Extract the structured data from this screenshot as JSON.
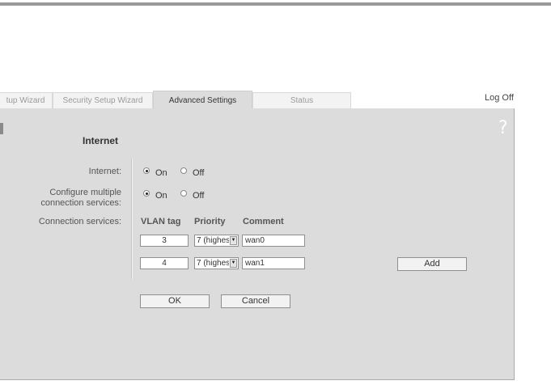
{
  "tabs": [
    {
      "label": "tup Wizard"
    },
    {
      "label": "Security Setup Wizard"
    },
    {
      "label": "Advanced Settings"
    },
    {
      "label": "Status"
    }
  ],
  "active_tab": "Advanced Settings",
  "logoff_label": "Log Off",
  "help_icon": "?",
  "section_title": "Internet",
  "internet": {
    "label": "Internet:",
    "on_label": "On",
    "off_label": "Off",
    "selected": "On"
  },
  "multiple": {
    "label_line1": "Configure multiple",
    "label_line2": "connection services:",
    "on_label": "On",
    "off_label": "Off",
    "selected": "On"
  },
  "services": {
    "label": "Connection services:",
    "columns": {
      "vlan": "VLAN tag",
      "priority": "Priority",
      "comment": "Comment"
    },
    "rows": [
      {
        "vlan": "3",
        "priority": "7 (highes",
        "comment": "wan0"
      },
      {
        "vlan": "4",
        "priority": "7 (highes",
        "comment": "wan1"
      }
    ],
    "add_label": "Add"
  },
  "buttons": {
    "ok": "OK",
    "cancel": "Cancel"
  },
  "colors": {
    "panel": "#dcdcdc",
    "rule": "#9a9a9a"
  }
}
